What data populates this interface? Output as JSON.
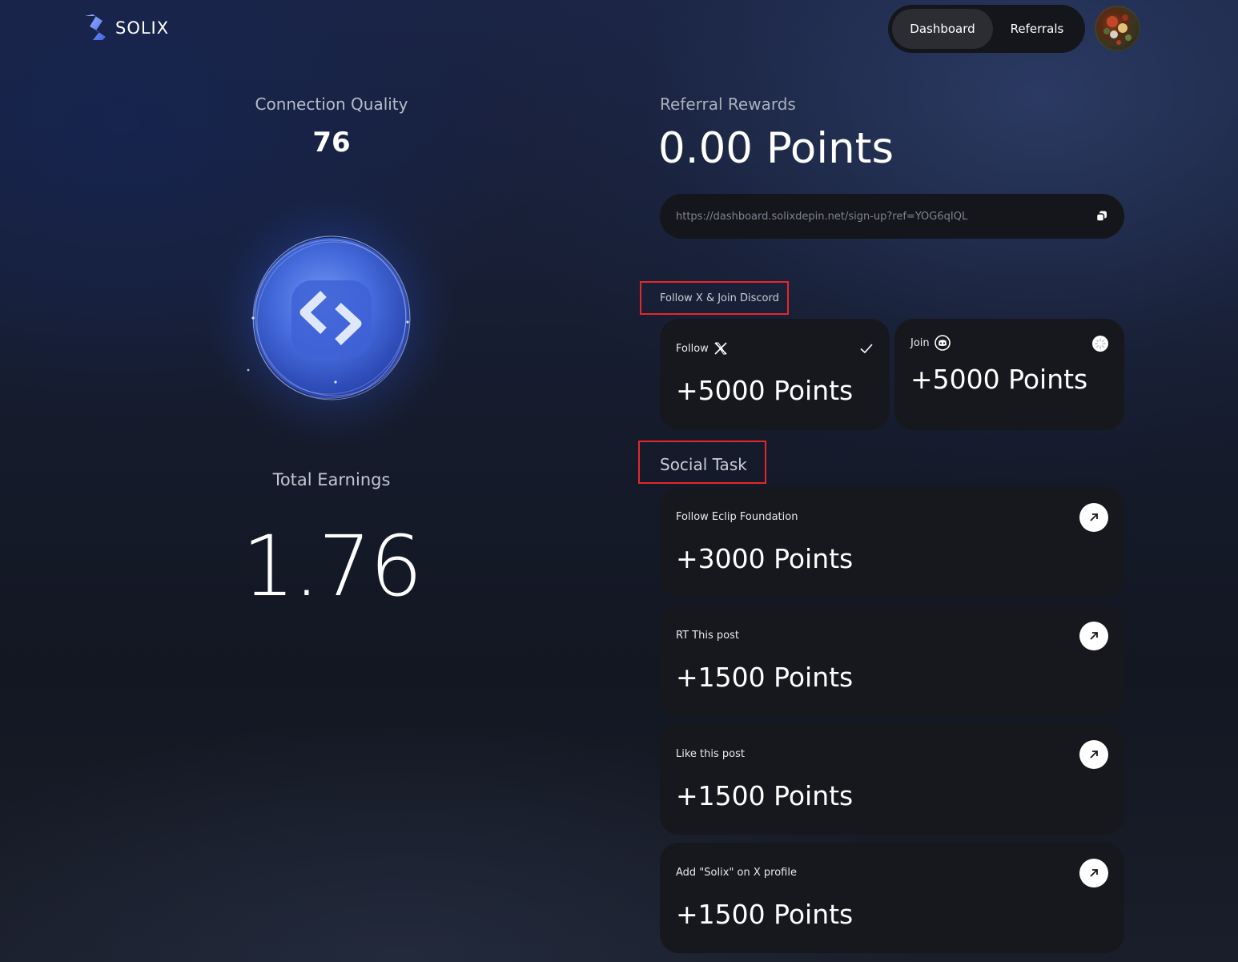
{
  "header": {
    "brand": "SOLIX",
    "tabs": [
      {
        "label": "Dashboard",
        "active": true
      },
      {
        "label": "Referrals",
        "active": false
      }
    ]
  },
  "left": {
    "connection_quality_label": "Connection Quality",
    "connection_quality_value": "76",
    "total_earnings_label": "Total Earnings",
    "total_earnings_value": "1.76"
  },
  "referral": {
    "label": "Referral Rewards",
    "points": "0.00 Points",
    "link": "https://dashboard.solixdepin.net/sign-up?ref=YOG6qIQL"
  },
  "follow_section": {
    "title": "Follow X & Join Discord",
    "cards": [
      {
        "action": "Follow",
        "points": "+5000 Points",
        "status": "completed",
        "icon": "x-logo-icon"
      },
      {
        "action": "Join",
        "points": "+5000 Points",
        "status": "pending",
        "icon": "discord-icon"
      }
    ]
  },
  "social_section": {
    "title": "Social Task",
    "tasks": [
      {
        "label": "Follow Eclip Foundation",
        "points": "+3000 Points"
      },
      {
        "label": "RT This post",
        "points": "+1500 Points"
      },
      {
        "label": "Like this post",
        "points": "+1500 Points"
      },
      {
        "label": "Add \"Solix\" on X profile",
        "points": "+1500 Points"
      }
    ]
  },
  "colors": {
    "accent_blue": "#3f6ff0",
    "card_bg": "#17181d",
    "highlight_red": "#e8262a"
  }
}
